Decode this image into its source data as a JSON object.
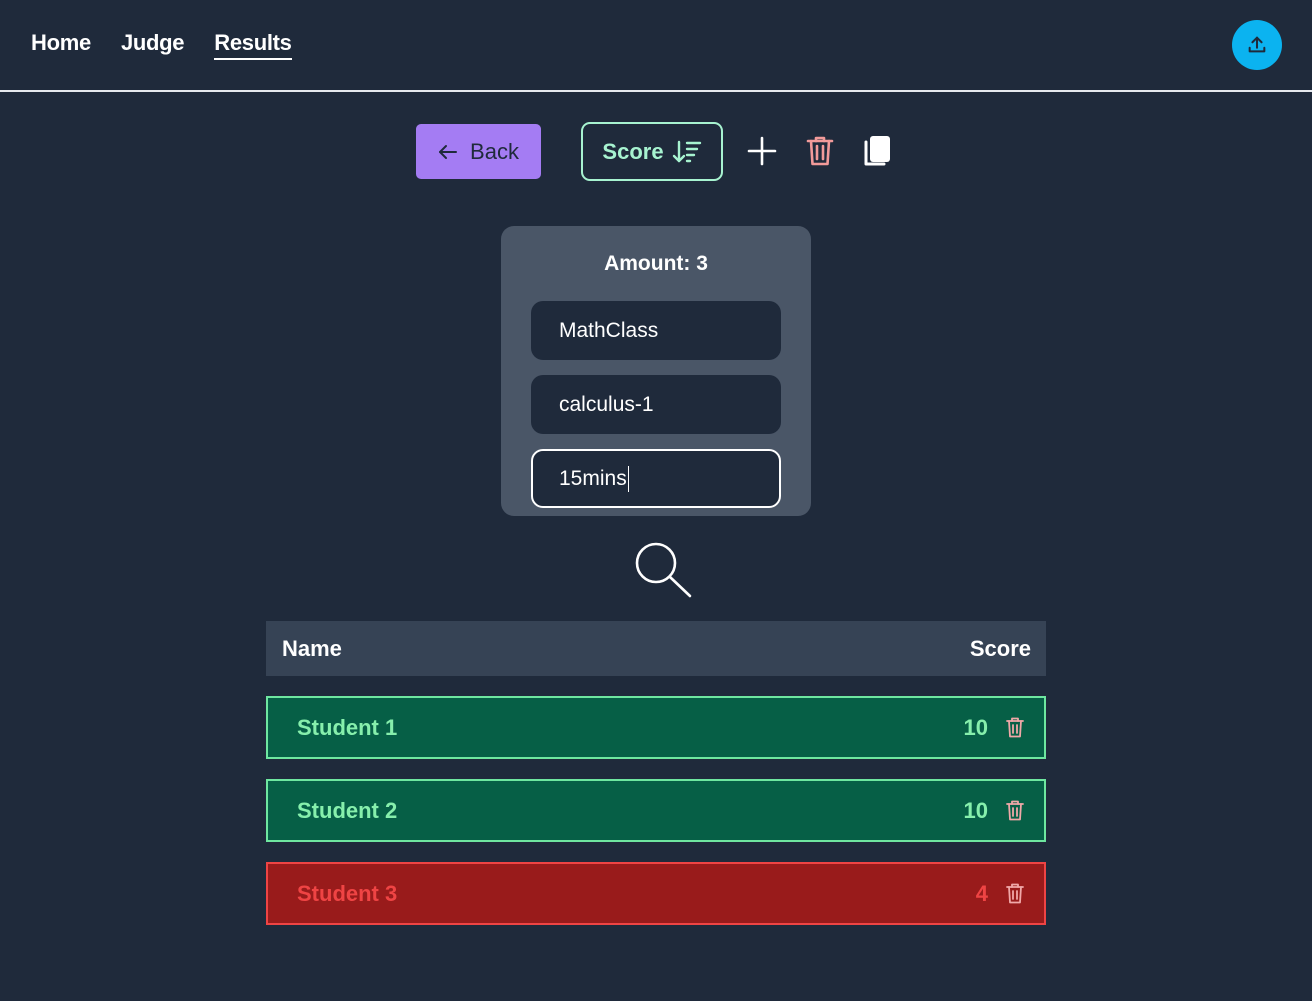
{
  "nav": {
    "items": [
      {
        "label": "Home",
        "active": false
      },
      {
        "label": "Judge",
        "active": false
      },
      {
        "label": "Results",
        "active": true
      }
    ],
    "upload_icon": "upload-icon",
    "upload_color": "#0bb3f0"
  },
  "toolbar": {
    "back_label": "Back",
    "back_icon": "arrow-left-icon",
    "sort_label": "Score",
    "sort_icon": "sort-descending-icon",
    "add_icon": "plus-icon",
    "delete_icon": "trash-icon",
    "copy_icon": "copy-icon",
    "accent_color": "#a47cf3"
  },
  "card": {
    "title": "Amount: 3",
    "fields": [
      {
        "value": "MathClass",
        "focused": false
      },
      {
        "value": "calculus-1",
        "focused": false
      },
      {
        "value": "15mins",
        "focused": true
      }
    ]
  },
  "search": {
    "icon": "search-icon"
  },
  "table": {
    "headers": {
      "name": "Name",
      "score": "Score"
    },
    "rows": [
      {
        "name": "Student 1",
        "score": "10",
        "status": "pass"
      },
      {
        "name": "Student 2",
        "score": "10",
        "status": "pass"
      },
      {
        "name": "Student 3",
        "score": "4",
        "status": "fail"
      }
    ],
    "colors": {
      "pass": "#065f46",
      "fail": "#991b1b"
    }
  }
}
